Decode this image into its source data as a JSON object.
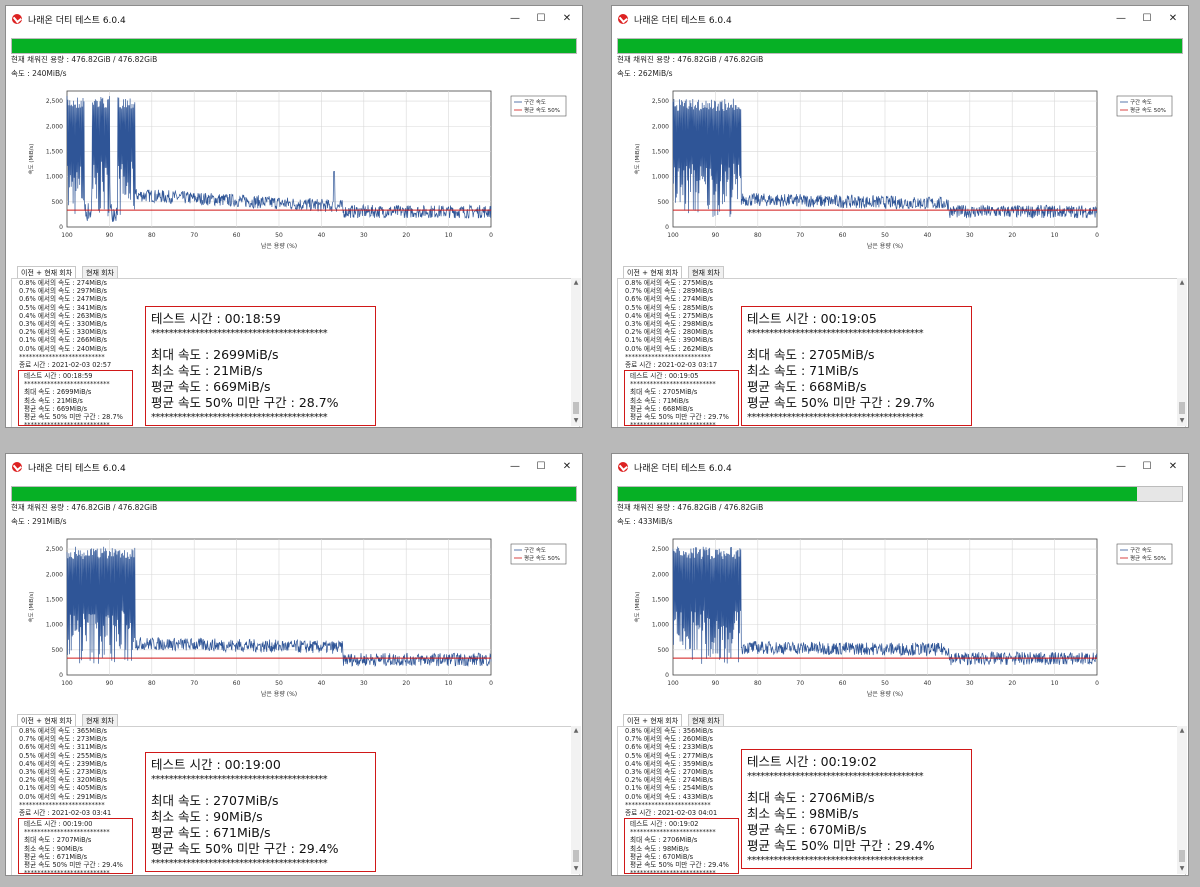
{
  "title": "나래온 더티 테스트 6.0.4",
  "window_controls": {
    "minimize": "—",
    "maximize": "☐",
    "close": "✕"
  },
  "capacity_label": "현재 채워진 용량 : 476.82GiB / 476.82GiB",
  "speed_prefix": "속도 : ",
  "tabs": [
    "이전 + 현재 회차",
    "현재 회차"
  ],
  "chart_common": {
    "type": "line",
    "ylabel": "속도 (MiB/s)",
    "xlabel": "남은 용량 (%)",
    "y_ticks": [
      "2,500",
      "2,000",
      "1,500",
      "1,000",
      "500",
      "0"
    ],
    "x_ticks": [
      "100",
      "90",
      "80",
      "70",
      "60",
      "50",
      "40",
      "30",
      "20",
      "10",
      "0"
    ],
    "ylim": [
      0,
      2700
    ],
    "xlim": [
      100,
      0
    ],
    "legend": [
      "구간 속도",
      "평균 속도 50%"
    ],
    "legend_position": "top-right",
    "grid": true,
    "colors": {
      "series": "#2f5597",
      "average_line": "#d01818"
    }
  },
  "colors": {
    "progress": "#06b025",
    "highlight_border": "#d01818"
  },
  "scroll": {
    "up": "▲",
    "down": "▼"
  },
  "windows": [
    {
      "speed": "240MiB/s",
      "progress": 1.0,
      "log_lines": [
        "0.8% 에서의 속도 : 274MiB/s",
        "0.7% 에서의 속도 : 297MiB/s",
        "0.6% 에서의 속도 : 247MiB/s",
        "0.5% 에서의 속도 : 341MiB/s",
        "0.4% 에서의 속도 : 263MiB/s",
        "0.3% 에서의 속도 : 330MiB/s",
        "0.2% 에서의 속도 : 330MiB/s",
        "0.1% 에서의 속도 : 266MiB/s",
        "0.0% 에서의 속도 : 240MiB/s",
        "**************************",
        "종료 시간 : 2021-02-03 02:57"
      ],
      "summary_small": [
        "테스트 시간 : 00:18:59",
        "**************************",
        "최대 속도 : 2699MiB/s",
        "최소 속도 : 21MiB/s",
        "평균 속도 : 669MiB/s",
        "평균 속도 50% 미만 구간 : 28.7%",
        "**************************"
      ],
      "summary_big": {
        "time": "테스트 시간 : 00:18:59",
        "stars": "****************************************",
        "max": "최대 속도 : 2699MiB/s",
        "min": "최소 속도 : 21MiB/s",
        "avg": "평균 속도 : 669MiB/s",
        "below": "평균 속도 50% 미만 구간 : 28.7%"
      },
      "chart_data": {
        "type": "line",
        "segments": [
          {
            "x": [
              100,
              84
            ],
            "level": 2600,
            "low": 100,
            "note": "burst"
          },
          {
            "x": [
              84,
              35
            ],
            "level": [
              650,
              420
            ]
          },
          {
            "x": [
              35,
              0
            ],
            "level": 320
          }
        ],
        "spike": {
          "x": 37,
          "y": 1100
        },
        "average_50": {
          "x": [
            100,
            84,
            84,
            35,
            35,
            0
          ],
          "y": [
            335,
            335,
            335,
            335,
            335,
            335
          ]
        }
      }
    },
    {
      "speed": "262MiB/s",
      "progress": 1.0,
      "log_lines": [
        "0.8% 에서의 속도 : 275MiB/s",
        "0.7% 에서의 속도 : 289MiB/s",
        "0.6% 에서의 속도 : 274MiB/s",
        "0.5% 에서의 속도 : 285MiB/s",
        "0.4% 에서의 속도 : 275MiB/s",
        "0.3% 에서의 속도 : 298MiB/s",
        "0.2% 에서의 속도 : 280MiB/s",
        "0.1% 에서의 속도 : 390MiB/s",
        "0.0% 에서의 속도 : 262MiB/s",
        "**************************",
        "종료 시간 : 2021-02-03 03:17"
      ],
      "summary_small": [
        "테스트 시간 : 00:19:05",
        "**************************",
        "최대 속도 : 2705MiB/s",
        "최소 속도 : 71MiB/s",
        "평균 속도 : 668MiB/s",
        "평균 속도 50% 미만 구간 : 29.7%",
        "**************************"
      ],
      "summary_big": {
        "time": "테스트 시간 : 00:19:05",
        "stars": "****************************************",
        "max": "최대 속도 : 2705MiB/s",
        "min": "최소 속도 : 71MiB/s",
        "avg": "평균 속도 : 668MiB/s",
        "below": "평균 속도 50% 미만 구간 : 29.7%"
      },
      "chart_data": {
        "type": "line",
        "segments": [
          {
            "x": [
              100,
              84
            ],
            "level": 2550
          },
          {
            "x": [
              84,
              35
            ],
            "level": [
              560,
              480
            ]
          },
          {
            "x": [
              35,
              0
            ],
            "level": 320
          }
        ],
        "average_50": {
          "x": [
            100,
            0
          ],
          "y": [
            335,
            335
          ]
        }
      }
    },
    {
      "speed": "291MiB/s",
      "progress": 1.0,
      "log_lines": [
        "0.8% 에서의 속도 : 365MiB/s",
        "0.7% 에서의 속도 : 273MiB/s",
        "0.6% 에서의 속도 : 311MiB/s",
        "0.5% 에서의 속도 : 255MiB/s",
        "0.4% 에서의 속도 : 239MiB/s",
        "0.3% 에서의 속도 : 273MiB/s",
        "0.2% 에서의 속도 : 320MiB/s",
        "0.1% 에서의 속도 : 405MiB/s",
        "0.0% 에서의 속도 : 291MiB/s",
        "**************************",
        "종료 시간 : 2021-02-03 03:41"
      ],
      "summary_small": [
        "테스트 시간 : 00:19:00",
        "**************************",
        "최대 속도 : 2707MiB/s",
        "최소 속도 : 90MiB/s",
        "평균 속도 : 671MiB/s",
        "평균 속도 50% 미만 구간 : 29.4%",
        "**************************"
      ],
      "summary_big": {
        "time": "테스트 시간 : 00:19:00",
        "stars": "****************************************",
        "max": "최대 속도 : 2707MiB/s",
        "min": "최소 속도 : 90MiB/s",
        "avg": "평균 속도 : 671MiB/s",
        "below": "평균 속도 50% 미만 구간 : 29.4%"
      },
      "chart_data": {
        "type": "line",
        "segments": [
          {
            "x": [
              100,
              84
            ],
            "level": 2550
          },
          {
            "x": [
              84,
              35
            ],
            "level": [
              640,
              560
            ]
          },
          {
            "x": [
              35,
              0
            ],
            "level": 320
          }
        ],
        "average_50": {
          "x": [
            100,
            0
          ],
          "y": [
            335,
            335
          ]
        }
      }
    },
    {
      "speed": "433MiB/s",
      "progress": 0.92,
      "log_lines": [
        "0.8% 에서의 속도 : 356MiB/s",
        "0.7% 에서의 속도 : 260MiB/s",
        "0.6% 에서의 속도 : 233MiB/s",
        "0.5% 에서의 속도 : 277MiB/s",
        "0.4% 에서의 속도 : 359MiB/s",
        "0.3% 에서의 속도 : 270MiB/s",
        "0.2% 에서의 속도 : 274MiB/s",
        "0.1% 에서의 속도 : 254MiB/s",
        "0.0% 에서의 속도 : 433MiB/s",
        "**************************",
        "종료 시간 : 2021-02-03 04:01"
      ],
      "summary_small": [
        "테스트 시간 : 00:19:02",
        "**************************",
        "최대 속도 : 2706MiB/s",
        "최소 속도 : 98MiB/s",
        "평균 속도 : 670MiB/s",
        "평균 속도 50% 미만 구간 : 29.4%",
        "**************************"
      ],
      "summary_big": {
        "time": "테스트 시간 : 00:19:02",
        "stars": "****************************************",
        "max": "최대 속도 : 2706MiB/s",
        "min": "최소 속도 : 98MiB/s",
        "avg": "평균 속도 : 670MiB/s",
        "below": "평균 속도 50% 미만 구간 : 29.4%"
      },
      "chart_data": {
        "type": "line",
        "segments": [
          {
            "x": [
              100,
              84
            ],
            "level": 2550
          },
          {
            "x": [
              84,
              35
            ],
            "level": [
              560,
              520
            ]
          },
          {
            "x": [
              35,
              0
            ],
            "level": 340
          }
        ],
        "average_50": {
          "x": [
            100,
            0
          ],
          "y": [
            335,
            335
          ]
        }
      }
    }
  ]
}
